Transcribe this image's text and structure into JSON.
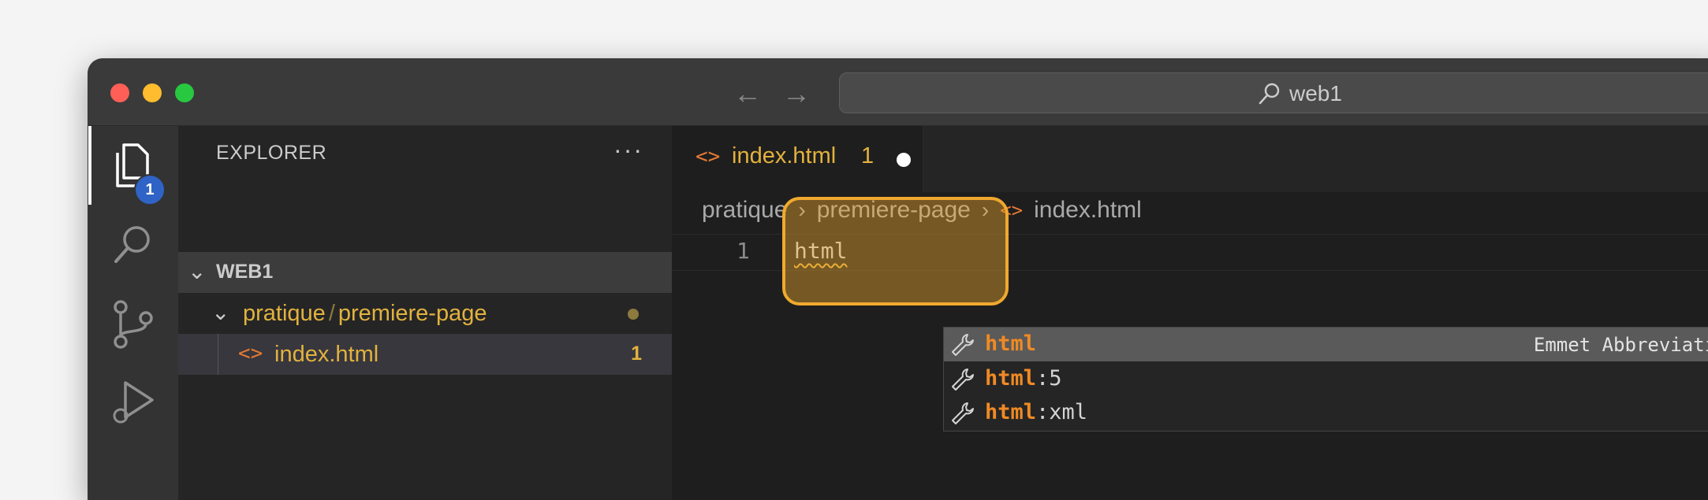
{
  "titlebar": {
    "search_text": "web1",
    "back_icon": "arrow-left-icon",
    "forward_icon": "arrow-right-icon"
  },
  "activity_bar": {
    "items": [
      {
        "name": "explorer",
        "icon": "files-icon",
        "active": true,
        "badge": "1"
      },
      {
        "name": "search",
        "icon": "search-icon"
      },
      {
        "name": "source-control",
        "icon": "source-control-icon"
      },
      {
        "name": "run-and-debug",
        "icon": "run-debug-icon"
      }
    ]
  },
  "sidebar": {
    "title": "EXPLORER",
    "more_label": "···",
    "root_label": "WEB1",
    "folder": {
      "part1": "pratique",
      "separator": "/",
      "part2": "premiere-page"
    },
    "file": {
      "icon": "<>",
      "label": "index.html",
      "problems": "1"
    }
  },
  "editor": {
    "tab": {
      "icon": "<>",
      "label": "index.html",
      "problems": "1"
    },
    "breadcrumbs": {
      "item1": "pratique",
      "item2": "premiere-page",
      "icon": "<>",
      "item3": "index.html"
    },
    "line_number": "1",
    "code": "html"
  },
  "suggestions": [
    {
      "match": "html",
      "rest": "",
      "detail": "Emmet Abbreviation",
      "selected": true
    },
    {
      "match": "html",
      "rest": ":5",
      "detail": "",
      "selected": false
    },
    {
      "match": "html",
      "rest": ":xml",
      "detail": "",
      "selected": false
    }
  ],
  "colors": {
    "accent_orange": "#f0a92e",
    "modified_yellow": "#e2b23e",
    "html_icon": "#e37933",
    "badge_blue": "#2f63c6"
  }
}
